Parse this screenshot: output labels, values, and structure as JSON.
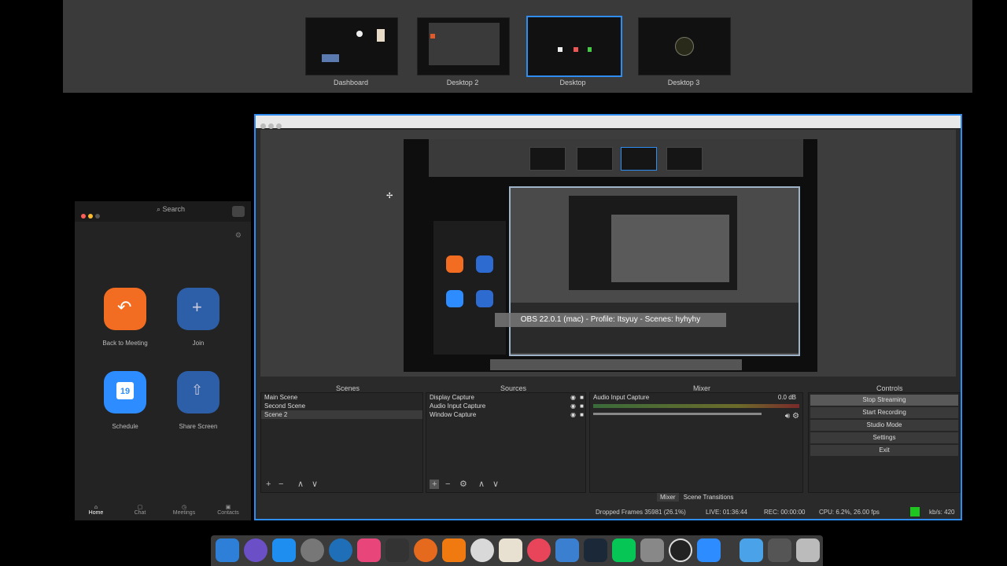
{
  "mission_control": {
    "desktops": [
      {
        "label": "Dashboard",
        "active": false
      },
      {
        "label": "Desktop 2",
        "active": false
      },
      {
        "label": "Desktop",
        "active": true
      },
      {
        "label": "Desktop 3",
        "active": false
      }
    ]
  },
  "obs": {
    "preview_caption": "OBS 22.0.1 (mac) - Profile: Itsyuy - Scenes: hyhyhy",
    "docks": {
      "scenes_title": "Scenes",
      "sources_title": "Sources",
      "mixer_title": "Mixer",
      "controls_title": "Controls"
    },
    "scenes": [
      "Main Scene",
      "Second Scene",
      "Scene 2"
    ],
    "sources": [
      "Display Capture",
      "Audio Input Capture",
      "Window Capture"
    ],
    "mixer": {
      "source": "Audio Input Capture",
      "db": "0.0 dB"
    },
    "controls": [
      "Stop Streaming",
      "Start Recording",
      "Studio Mode",
      "Settings",
      "Exit"
    ],
    "tabs": {
      "mixer": "Mixer",
      "transitions": "Scene Transitions"
    },
    "status": {
      "dropped": "Dropped Frames 35981 (26.1%)",
      "live": "LIVE: 01:36:44",
      "rec": "REC: 00:00:00",
      "cpu": "CPU: 6.2%, 26.00 fps",
      "kbs": "kb/s: 420"
    },
    "toolbar": {
      "add": "+",
      "remove": "−",
      "up": "∧",
      "down": "∨",
      "settings": "⚙"
    }
  },
  "zoom": {
    "search_placeholder": "Search",
    "actions": [
      {
        "label": "Back to Meeting",
        "icon": "back-arrow-icon",
        "color": "#f26d21"
      },
      {
        "label": "Join",
        "icon": "plus-icon",
        "color": "#2d6bd0"
      },
      {
        "label": "Schedule",
        "icon": "calendar-icon",
        "color": "#2d8cff",
        "day": "19"
      },
      {
        "label": "Share Screen",
        "icon": "share-up-icon",
        "color": "#2d6bd0"
      }
    ],
    "nav": [
      "Home",
      "Chat",
      "Meetings",
      "Contacts"
    ]
  }
}
